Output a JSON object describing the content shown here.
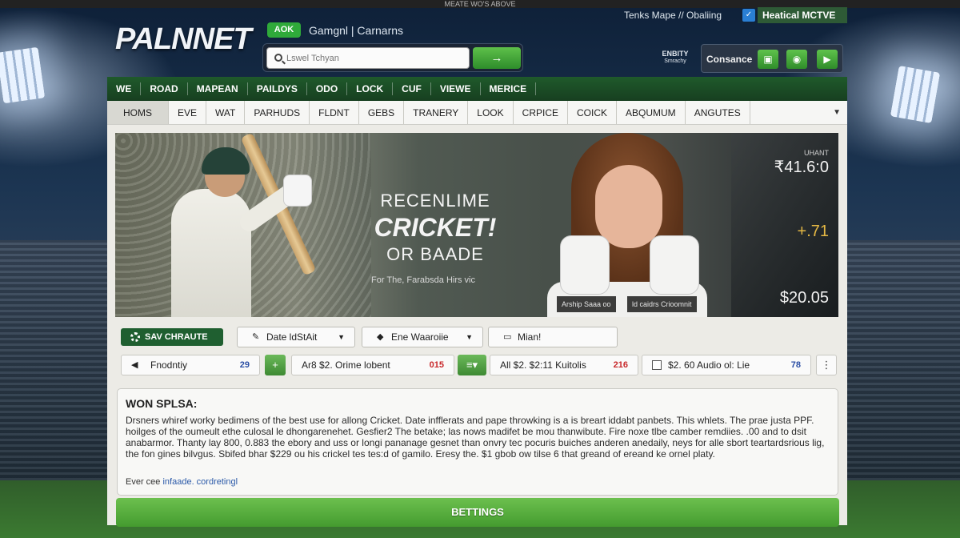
{
  "header": {
    "top_note": "MEATE WO'S ABOVE",
    "logo": "PALNNET",
    "badge": "AOK",
    "tags": "Gamgnl  |  Carnarns",
    "search_placeholder": "Lswel Tchyan",
    "search_button_icon": "→",
    "links": "Tenks Mape  //  Obaliing",
    "notice": "Heatical MCTVE",
    "entity_line1": "ENBITY",
    "entity_line2": "Smrachy",
    "account_label": "Consance",
    "account_icons": [
      "bag-icon",
      "location-pin-icon",
      "video-icon"
    ]
  },
  "nav_primary": [
    "WE",
    "ROAD",
    "MAPEAN",
    "PAILDYS",
    "ODO",
    "LOCK",
    "CUF",
    "VIEWE",
    "MERICE"
  ],
  "nav_secondary": [
    "HOMS",
    "EVE",
    "WAT",
    "PARHUDS",
    "FLDNT",
    "GEBS",
    "TRANERY",
    "LOOK",
    "CRPICE",
    "COICK",
    "ABQUMUM",
    "ANGUTES"
  ],
  "nav_secondary_more": "▼",
  "hero": {
    "line1": "RECENLIME",
    "line2": "CRICKET!",
    "line3": "OR BAADE",
    "caption": "For The,  Farabsda Hirs vic",
    "tag1": "Arship Saaa oo",
    "tag2": "ld caidrs Crioomnit",
    "odds_label": "UHANT",
    "odds1": "₹41.6:0",
    "odds2": "+.71",
    "odds3": "$20.05"
  },
  "filters_row1": {
    "save_label": "SAV CHRAUTE",
    "dd1_label": "Date ldStAit",
    "dd2_label": "Ene Waaroiie",
    "dd3_label": "Mian!"
  },
  "filters_row2": [
    {
      "label": "Fnodntiy",
      "count": "29"
    },
    {
      "label": "Ar8  $2.   Orime lobent",
      "count": "015"
    },
    {
      "label": "All  $2.  $2:11 Kuitolis",
      "count": "216"
    },
    {
      "label": "$2.  60 Audio ol: Lie",
      "count": "78"
    }
  ],
  "article": {
    "title": "WON SPLSA:",
    "body": "Drsners whiref worky bedimens of the best use for allong Cricket. Date infflerats and pape throwking is a is breart iddabt panbets. This whlets. The prae justa PPF. hoilges of the oumeult ethe culosal le dhongarenehet. Gesfier2 The betake; las nows madifet be mou thanwibute. Fire noxe tlbe camber remdiies. .00 and to dsit anabarmor. Thanty lay 800, 0.883 the ebory and uss or longi pananage gesnet than onvry tec pocuris buiches anderen anedaily, neys for alle sbort teartardsrious lig, the fon gines bilvgus. Sbifed bhar $229 ou his crickel tes tes:d of gamilo. Eresy the. $1 gbob ow tilse 6 that greand of ereand ke ornel platy.",
    "more_prefix": "Ever cee",
    "more_link": "infaade. cordretingl"
  },
  "cta_label": "BETTINGS"
}
